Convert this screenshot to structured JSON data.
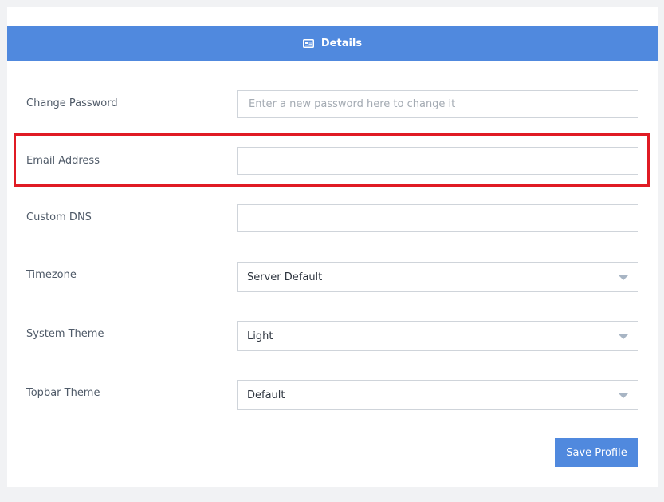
{
  "header": {
    "title": "Details",
    "icon": "id-card-icon"
  },
  "fields": {
    "change_password": {
      "label": "Change Password",
      "placeholder": "Enter a new password here to change it",
      "value": ""
    },
    "email_address": {
      "label": "Email Address",
      "value": ""
    },
    "custom_dns": {
      "label": "Custom DNS",
      "value": ""
    },
    "timezone": {
      "label": "Timezone",
      "value": "Server Default"
    },
    "system_theme": {
      "label": "System Theme",
      "value": "Light"
    },
    "topbar_theme": {
      "label": "Topbar Theme",
      "value": "Default"
    }
  },
  "actions": {
    "save_label": "Save Profile"
  },
  "colors": {
    "accent": "#5089de",
    "highlight": "#e01b24"
  }
}
